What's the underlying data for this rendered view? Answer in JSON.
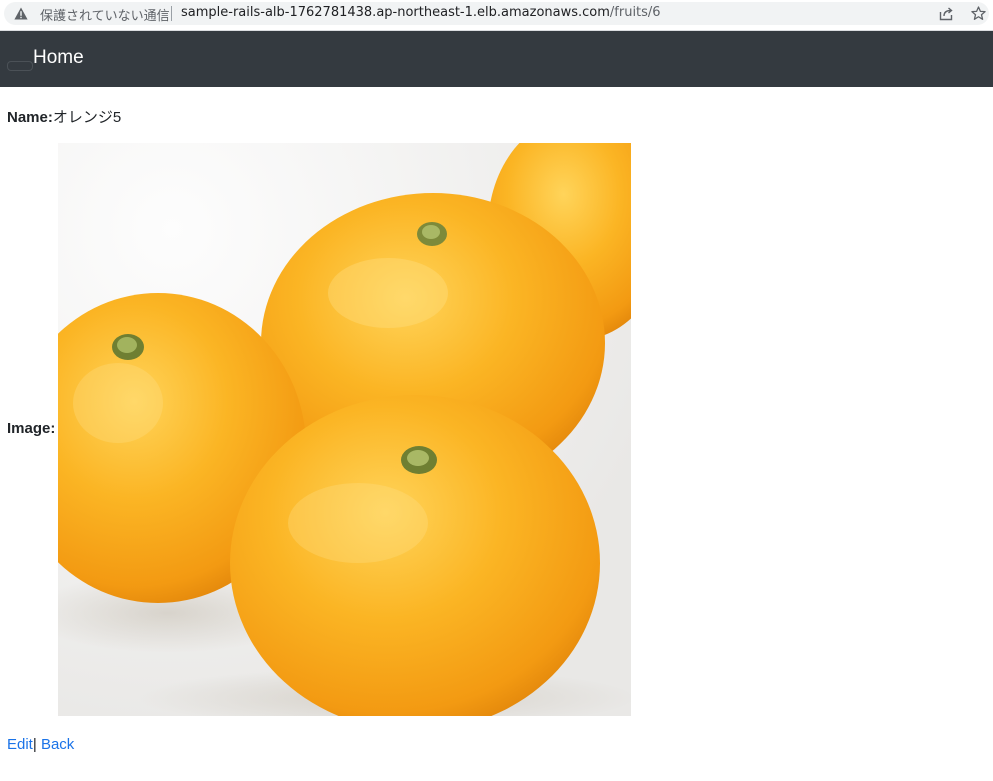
{
  "browser": {
    "security_label": "保護されていない通信",
    "url_host": "sample-rails-alb-1762781438.ap-northeast-1.elb.amazonaws.com",
    "url_path": "/fruits/6"
  },
  "navbar": {
    "brand": "Home"
  },
  "fruit": {
    "name_label": "Name:",
    "name_value": "オレンジ5",
    "image_label": "Image:"
  },
  "actions": {
    "edit_label": "Edit",
    "separator": "|",
    "back_label": "Back"
  },
  "colors": {
    "navbar_bg": "#343a40",
    "link": "#1a73e8",
    "orange": "#f7a51a"
  }
}
